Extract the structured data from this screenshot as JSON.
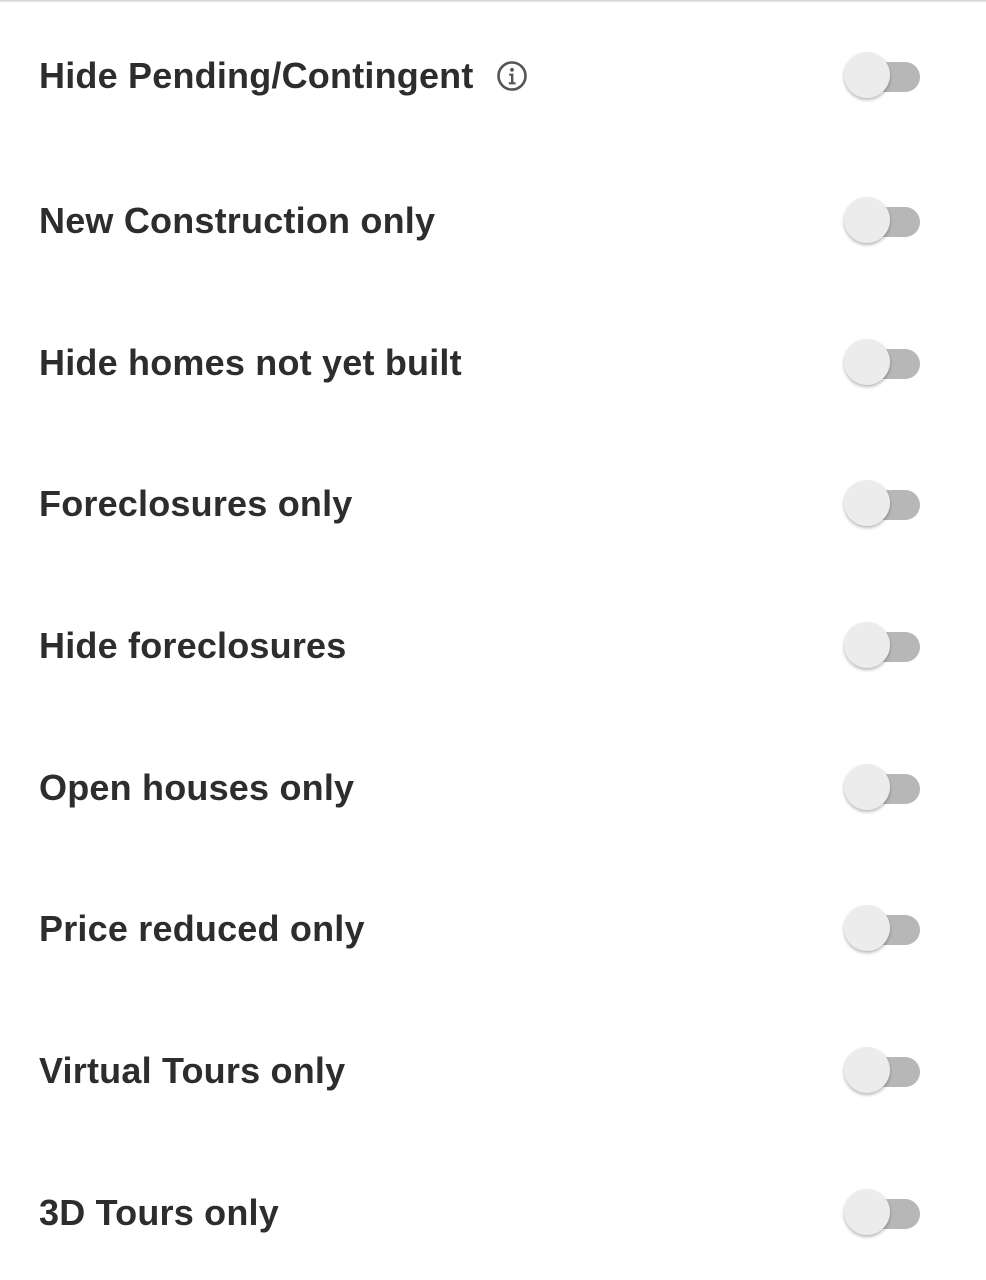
{
  "filters": [
    {
      "label": "Hide Pending/Contingent",
      "has_info": true,
      "enabled": false,
      "icon": "info-icon"
    },
    {
      "label": "New Construction only",
      "enabled": false
    },
    {
      "label": "Hide homes not yet built",
      "enabled": false
    },
    {
      "label": "Foreclosures only",
      "enabled": false
    },
    {
      "label": "Hide foreclosures",
      "enabled": false
    },
    {
      "label": "Open houses only",
      "enabled": false
    },
    {
      "label": "Price reduced only",
      "enabled": false
    },
    {
      "label": "Virtual Tours only",
      "enabled": false
    },
    {
      "label": "3D Tours only",
      "enabled": false
    }
  ],
  "colors": {
    "text": "#2d2d2d",
    "track_off": "#b7b7b7",
    "thumb_off": "#ececec",
    "background": "#ffffff"
  }
}
